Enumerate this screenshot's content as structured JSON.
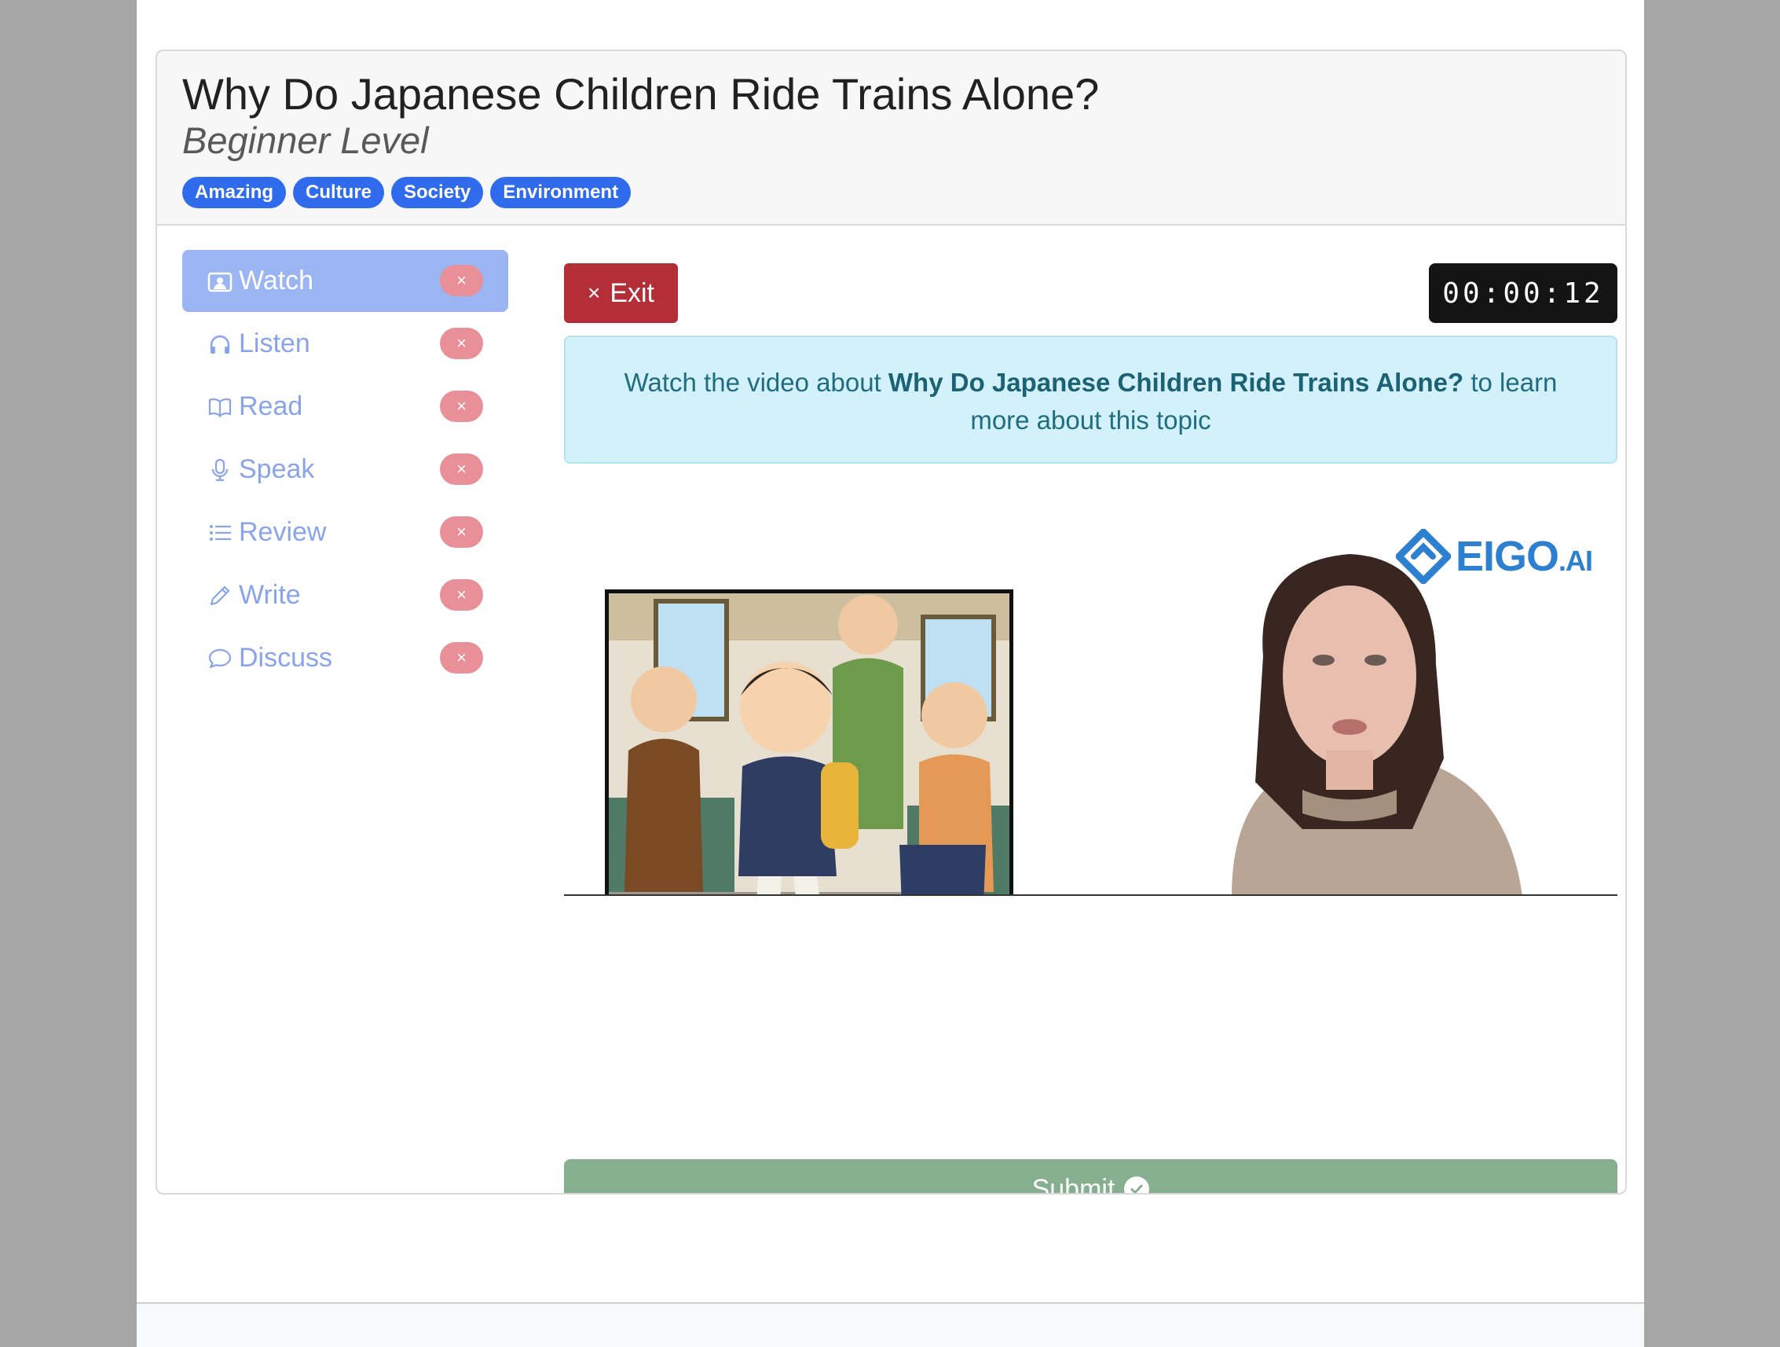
{
  "lesson": {
    "title": "Why Do Japanese Children Ride Trains Alone?",
    "level": "Beginner Level",
    "tags": [
      "Amazing",
      "Culture",
      "Society",
      "Environment"
    ]
  },
  "sidebar": {
    "items": [
      {
        "label": "Watch",
        "icon": "video-person-icon",
        "active": true,
        "badge": "×"
      },
      {
        "label": "Listen",
        "icon": "headphones-icon",
        "active": false,
        "badge": "×"
      },
      {
        "label": "Read",
        "icon": "book-icon",
        "active": false,
        "badge": "×"
      },
      {
        "label": "Speak",
        "icon": "microphone-icon",
        "active": false,
        "badge": "×"
      },
      {
        "label": "Review",
        "icon": "list-icon",
        "active": false,
        "badge": "×"
      },
      {
        "label": "Write",
        "icon": "pencil-icon",
        "active": false,
        "badge": "×"
      },
      {
        "label": "Discuss",
        "icon": "chat-bubble-icon",
        "active": false,
        "badge": "×"
      }
    ]
  },
  "toolbar": {
    "exit_icon": "×",
    "exit_label": "Exit",
    "timer": "00:00:12"
  },
  "info": {
    "prefix": "Watch the video about ",
    "topic": "Why Do Japanese Children Ride Trains Alone?",
    "suffix": " to learn more about this topic"
  },
  "video": {
    "logo_main": "EIGO",
    "logo_suffix": ".AI"
  },
  "submit": {
    "label": "Submit"
  },
  "colors": {
    "tag": "#2f6bec",
    "active_nav": "#9bb5f2",
    "exit": "#b32e36",
    "submit": "#85af8e",
    "info_bg": "#d2f1fa"
  }
}
